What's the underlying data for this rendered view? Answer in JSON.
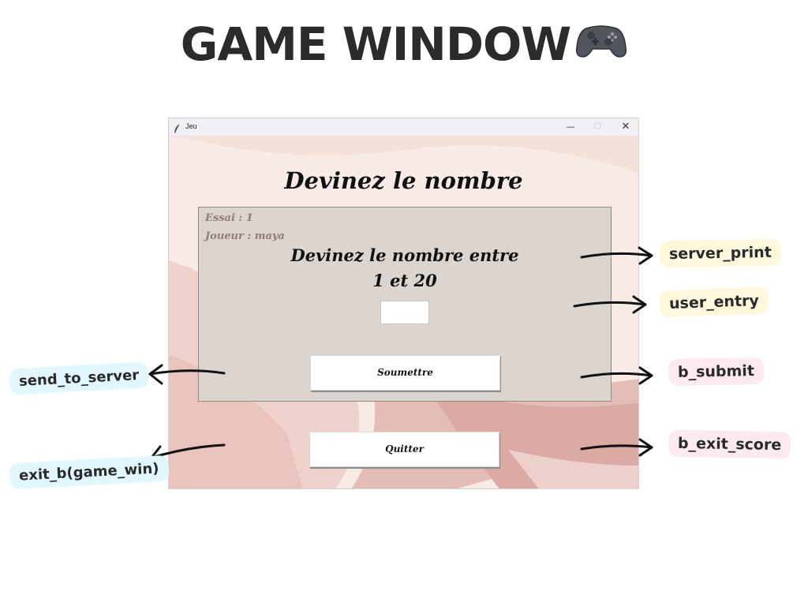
{
  "title": "GAME WINDOW",
  "title_icon": "gamepad-icon",
  "window": {
    "title": "Jeu",
    "icon": "feather-icon",
    "controls": {
      "minimize": "—",
      "maximize": "☐",
      "close": "✕"
    },
    "heading": "Devinez le nombre",
    "essai": "Essai : 1",
    "joueur": "Joueur : maya",
    "prompt_line1": "Devinez le nombre entre",
    "prompt_line2": "1 et 20",
    "entry_value": "",
    "submit_label": "Soumettre",
    "quit_label": "Quitter"
  },
  "annotations": {
    "server_print": "server_print",
    "user_entry": "user_entry",
    "b_submit": "b_submit",
    "b_exit_score": "b_exit_score",
    "send_to_server": "send_to_server",
    "exit_b": "exit_b(game_win)"
  },
  "colors": {
    "tag_yellow": "#fdf7dc",
    "tag_pink": "#fdeaf0",
    "tag_blue": "#e2f6fd",
    "panel": "#dbd4cf",
    "window_bg": "#f6e6e0"
  }
}
